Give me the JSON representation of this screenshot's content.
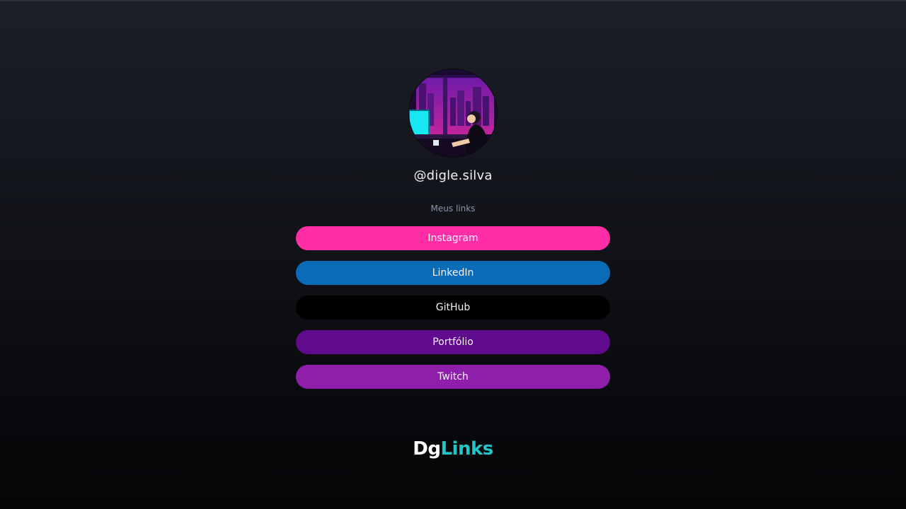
{
  "profile": {
    "avatar_icon": "lofi-room-illustration",
    "username": "@digle.silva",
    "subtitle": "Meus links"
  },
  "links": [
    {
      "label": "Instagram",
      "color": "#ff2ea6"
    },
    {
      "label": "LinkedIn",
      "color": "#0a6bb8"
    },
    {
      "label": "GitHub",
      "color": "#000000"
    },
    {
      "label": "Portfólio",
      "color": "#600a8d"
    },
    {
      "label": "Twitch",
      "color": "#8f1faa"
    }
  ],
  "footer": {
    "logo_part1": "Dg",
    "logo_part2": "Links",
    "logo_part1_color": "#ffffff",
    "logo_part2_color": "#1fc7c9"
  }
}
